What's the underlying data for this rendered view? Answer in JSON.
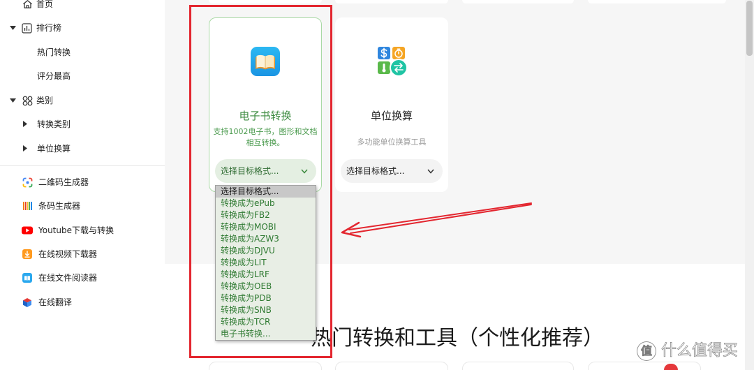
{
  "sidebar": {
    "home": {
      "label": "首页",
      "icon": "home-icon"
    },
    "ranking": {
      "label": "排行榜",
      "icon": "bar-chart-icon",
      "expanded": true,
      "items": [
        {
          "label": "热门转换"
        },
        {
          "label": "评分最高"
        }
      ]
    },
    "categories": {
      "label": "类别",
      "icon": "grid-icon",
      "expanded": true,
      "items": [
        {
          "label": "转换类别",
          "expanded": false
        },
        {
          "label": "单位换算",
          "expanded": false
        }
      ]
    },
    "tools": [
      {
        "label": "二维码生成器",
        "icon": "qr-code-icon"
      },
      {
        "label": "条码生成器",
        "icon": "barcode-icon"
      },
      {
        "label": "Youtube下载与转换",
        "icon": "youtube-icon"
      },
      {
        "label": "在线视频下载器",
        "icon": "video-download-icon"
      },
      {
        "label": "在线文件阅读器",
        "icon": "file-reader-icon"
      },
      {
        "label": "在线翻译",
        "icon": "translate-icon"
      }
    ]
  },
  "cards": [
    {
      "title": "电子书转换",
      "description_lines": [
        "支持1002电子书，图形和文档",
        "相互转换。"
      ],
      "icon": "ebook-icon",
      "select_value": "选择目标格式...",
      "active": true
    },
    {
      "title": "单位换算",
      "description_lines": [
        "多功能单位换算工具"
      ],
      "icon": "unit-conversion-icon",
      "select_value": "选择目标格式...",
      "active": false
    }
  ],
  "dropdown": {
    "open": true,
    "selected_index": 0,
    "options": [
      "选择目标格式...",
      "转换成为ePub",
      "转换成为FB2",
      "转换成为MOBI",
      "转换成为AZW3",
      "转换成为DJVU",
      "转换成为LIT",
      "转换成为LRF",
      "转换成为OEB",
      "转换成为PDB",
      "转换成为SNB",
      "转换成为TCR",
      "电子书转换..."
    ]
  },
  "section": {
    "heading": "热门转换和工具（个性化推荐）"
  },
  "watermark": {
    "badge": "值",
    "text": "什么值得买"
  },
  "colors": {
    "accent_green": "#3b8a3e",
    "active_card_border": "#a9d9a5",
    "annotation_red": "#e3262f",
    "notification_red": "#e5383b",
    "page_background": "#f6f6f6"
  }
}
